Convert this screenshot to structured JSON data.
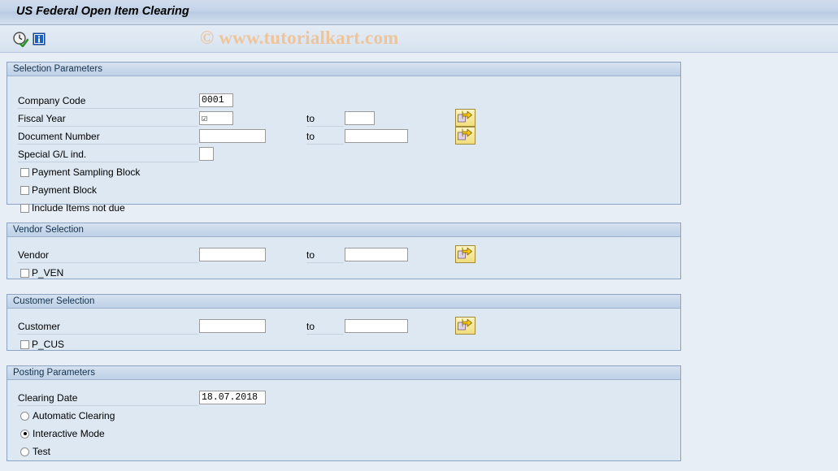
{
  "window": {
    "title": "US Federal Open Item Clearing"
  },
  "toolbar": {
    "execute_icon": "clock-check-icon",
    "info_icon": "info-icon"
  },
  "watermark": {
    "text": "© www.tutorialkart.com",
    "color": "#eec49a"
  },
  "sections": {
    "selection": {
      "header": "Selection Parameters",
      "fields": [
        {
          "label": "Company Code",
          "value": "0001",
          "to_label": "",
          "to_value": ""
        },
        {
          "label": "Fiscal Year",
          "value": "☑",
          "to_label": "to",
          "to_value": ""
        },
        {
          "label": "Document Number",
          "value": "",
          "to_label": "to",
          "to_value": ""
        },
        {
          "label": "Special G/L ind.",
          "value": "",
          "to_label": "",
          "to_value": ""
        }
      ],
      "checkboxes": [
        {
          "label": "Payment Sampling Block",
          "checked": false
        },
        {
          "label": "Payment Block",
          "checked": false
        },
        {
          "label": "Include Items not due",
          "checked": false
        }
      ],
      "multi_select_buttons": 2
    },
    "vendor": {
      "header": "Vendor Selection",
      "fields": [
        {
          "label": "Vendor",
          "value": "",
          "to_label": "to",
          "to_value": ""
        }
      ],
      "checkboxes": [
        {
          "label": "P_VEN",
          "checked": false
        }
      ],
      "multi_select_buttons": 1
    },
    "customer": {
      "header": "Customer Selection",
      "fields": [
        {
          "label": "Customer",
          "value": "",
          "to_label": "to",
          "to_value": ""
        }
      ],
      "checkboxes": [
        {
          "label": "P_CUS",
          "checked": false
        }
      ],
      "multi_select_buttons": 1
    },
    "posting": {
      "header": "Posting Parameters",
      "fields": [
        {
          "label": "Clearing Date",
          "value": "18.07.2018",
          "to_label": "",
          "to_value": ""
        }
      ],
      "radios": [
        {
          "label": "Automatic Clearing",
          "selected": false
        },
        {
          "label": "Interactive Mode",
          "selected": true
        },
        {
          "label": "Test",
          "selected": false
        }
      ]
    }
  }
}
